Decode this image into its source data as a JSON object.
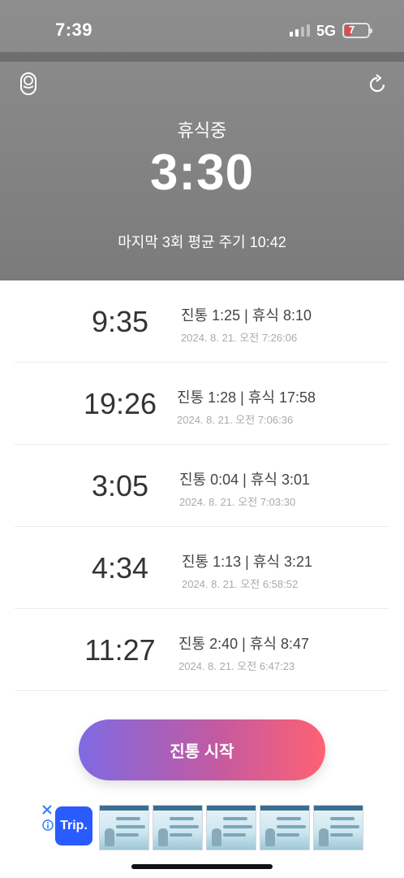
{
  "status_bar": {
    "time": "7:39",
    "network": "5G",
    "battery": "7"
  },
  "header": {
    "state_label": "휴식중",
    "timer": "3:30",
    "average_label": "마지막 3회 평균 주기 10:42"
  },
  "contractions": [
    {
      "duration": "9:35",
      "summary": "진통 1:25 | 휴식 8:10",
      "timestamp": "2024. 8. 21. 오전 7:26:06"
    },
    {
      "duration": "19:26",
      "summary": "진통 1:28 | 휴식 17:58",
      "timestamp": "2024. 8. 21. 오전 7:06:36"
    },
    {
      "duration": "3:05",
      "summary": "진통 0:04 | 휴식 3:01",
      "timestamp": "2024. 8. 21. 오전 7:03:30"
    },
    {
      "duration": "4:34",
      "summary": "진통 1:13 | 휴식 3:21",
      "timestamp": "2024. 8. 21. 오전 6:58:52"
    },
    {
      "duration": "11:27",
      "summary": "진통 2:40 | 휴식 8:47",
      "timestamp": "2024. 8. 21. 오전 6:47:23"
    }
  ],
  "start_button": {
    "label": "진통 시작"
  },
  "ad": {
    "brand": "Trip."
  },
  "colors": {
    "header_bg": "#8e8e8e",
    "button_gradient_start": "#7f6ae3",
    "button_gradient_end": "#ff6173",
    "ad_brand": "#2a5bff"
  },
  "icons": [
    "baby-icon",
    "refresh-icon",
    "close-icon",
    "info-icon"
  ]
}
